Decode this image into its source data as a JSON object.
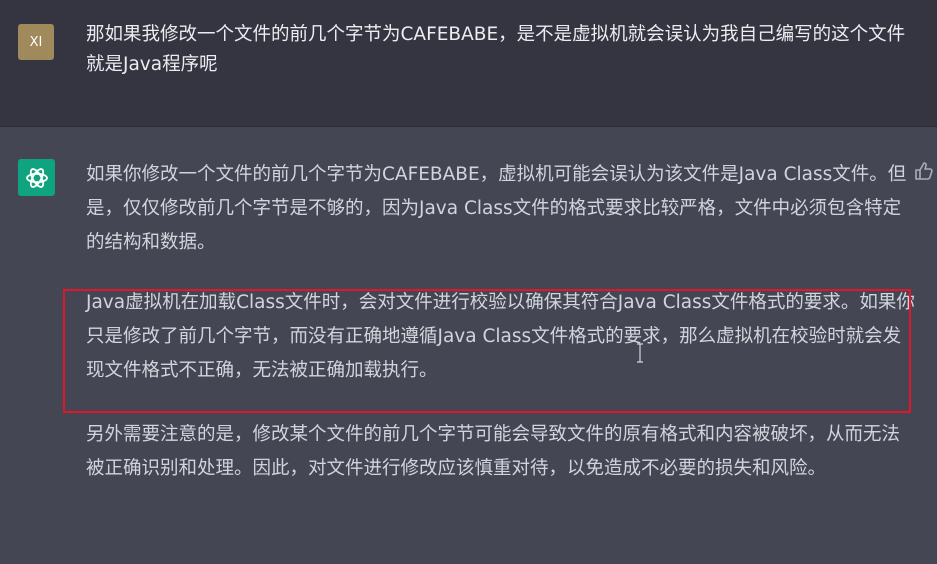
{
  "user": {
    "avatar_text": "XI",
    "message": "那如果我修改一个文件的前几个字节为CAFEBABE，是不是虚拟机就会误认为我自己编写的这个文件就是Java程序呢"
  },
  "assistant": {
    "paragraphs": [
      "如果你修改一个文件的前几个字节为CAFEBABE，虚拟机可能会误认为该文件是Java Class文件。但是，仅仅修改前几个字节是不够的，因为Java Class文件的格式要求比较严格，文件中必须包含特定的结构和数据。",
      "Java虚拟机在加载Class文件时，会对文件进行校验以确保其符合Java Class文件格式的要求。如果你只是修改了前几个字节，而没有正确地遵循Java Class文件格式的要求，那么虚拟机在校验时就会发现文件格式不正确，无法被正确加载执行。",
      "另外需要注意的是，修改某个文件的前几个字节可能会导致文件的原有格式和内容被破坏，从而无法被正确识别和处理。因此，对文件进行修改应该慎重对待，以免造成不必要的损失和风险。"
    ]
  },
  "icons": {
    "user_avatar": "user-avatar",
    "assistant_avatar": "openai-logo-icon",
    "feedback": "thumbs-up-icon",
    "cursor": "text-cursor-icon"
  },
  "colors": {
    "user_bg": "#343541",
    "assistant_bg": "#444654",
    "user_avatar_bg": "#a08a5b",
    "assistant_avatar_bg": "#10a37f",
    "highlight_border": "#e0162b"
  }
}
